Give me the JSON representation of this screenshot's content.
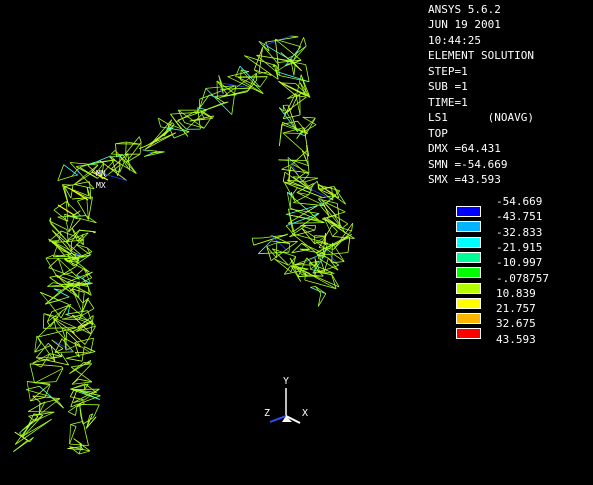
{
  "header": {
    "software": "ANSYS 5.6.2",
    "date": "JUN 19 2001",
    "time": "10:44:25",
    "plot_type": "ELEMENT SOLUTION",
    "step": "STEP=1",
    "sub": "SUB =1",
    "time_value": "TIME=1",
    "result_item": "LS1      (NOAVG)",
    "location": "TOP",
    "dmx": "DMX =64.431",
    "smn": "SMN =-54.669",
    "smx": "SMX =43.593"
  },
  "contour_legend": {
    "levels": [
      "-54.669",
      "-43.751",
      "-32.833",
      "-21.915",
      "-10.997",
      "-.078757",
      "10.839",
      "21.757",
      "32.675",
      "43.593"
    ],
    "band_colors": [
      "#0000ff",
      "#00b4ff",
      "#00ffff",
      "#00ff96",
      "#00ff00",
      "#b4ff00",
      "#ffff00",
      "#ffb400",
      "#ff0000"
    ]
  },
  "triad": {
    "y_label": "Y",
    "z_label": "Z",
    "x_label": "X"
  },
  "markers": {
    "mn_label": "MN",
    "mx_label": "MX"
  },
  "colors": {
    "background": "#000000",
    "mesh_primary": "#a8ff20",
    "mesh_secondary": "#d8ff40",
    "mesh_accent": "#40ffff",
    "mesh_blue": "#2040ff"
  }
}
